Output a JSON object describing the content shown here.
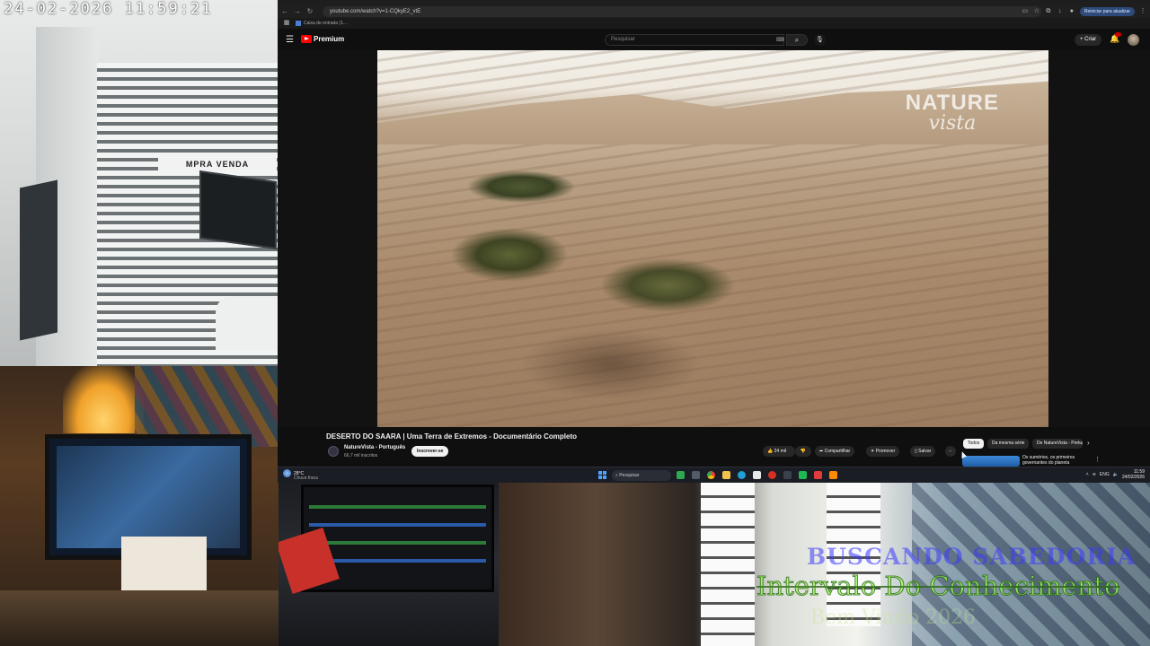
{
  "camera": {
    "timestamp": "24-02-2026  11:59:21",
    "shop_sign": "MPRA VENDA"
  },
  "browser": {
    "url": "youtube.com/watch?v=1-CQkyE2_vtE",
    "bookmark": "Caixa de entrada (1...",
    "restart_label": "Reiniciar para atualizar",
    "icons": [
      "back-icon",
      "forward-icon",
      "reload-icon",
      "star-icon",
      "extensions-icon",
      "profile-icon",
      "menu-dots-icon"
    ]
  },
  "youtube": {
    "logo_text": "Premium",
    "search_placeholder": "Pesquisar",
    "create_label": "+ Criar",
    "video": {
      "title": "DESERTO DO SAARA | Uma Terra de Extremos - Documentário Completo",
      "watermark_line1": "NATURE",
      "watermark_line2": "vista"
    },
    "channel": {
      "name": "NatureVista - Português",
      "subscribers": "66,7 mil inscritos",
      "subscribe_label": "Inscrever-se"
    },
    "actions": {
      "likes": "24 mil",
      "share": "Compartilhar",
      "promote": "Promover",
      "save": "Salvar",
      "more": "···"
    },
    "chips": [
      "Todos",
      "Da mesma série",
      "De NatureVista - Português"
    ],
    "recommendation_title": "Os sumérios, os primeiros governantes do planeta"
  },
  "taskbar": {
    "temperature": "28°C",
    "weather_desc": "Chuva fraca",
    "search_label": "Pesquisar",
    "language": "ENG",
    "time": "11:59",
    "date": "24/02/2026"
  },
  "overlay": {
    "line1": "BUSCANDO SABEDORIA",
    "line2": "Intervalo Do Conhecimento",
    "line3": "Bem Vindo 2026"
  },
  "colors": {
    "youtube_red": "#ff0000",
    "overlay_green": "#9cff5a",
    "overlay_blue": "#3a3aff"
  }
}
